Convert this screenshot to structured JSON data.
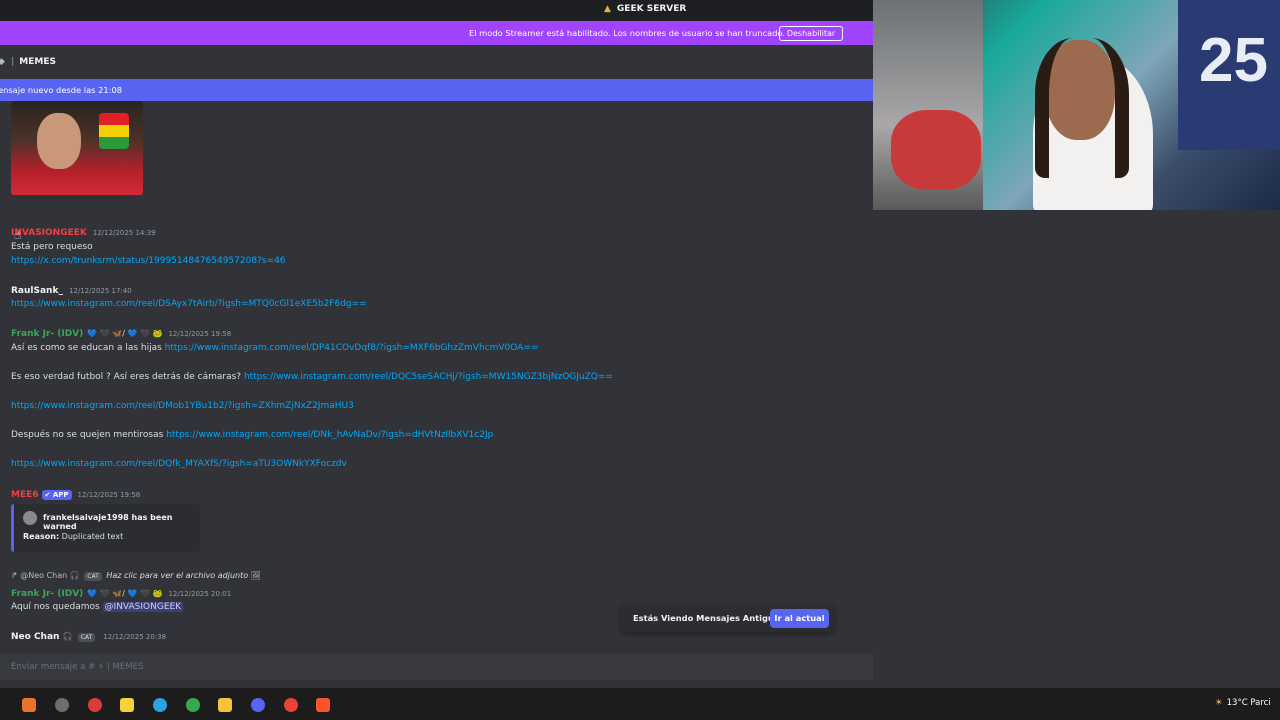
{
  "server": {
    "title": "GEEK SERVER"
  },
  "streamer": {
    "text": "El modo Streamer está habilitado. Los nombres de usuario se han truncado.",
    "button": "Deshabilitar"
  },
  "channel": {
    "name": "MEMES"
  },
  "new_messages": {
    "text": "ensaje nuevo desde las 21:08"
  },
  "messages": {
    "m1": {
      "author": "INVASIONGEEK",
      "time": "12/12/2025 14:39",
      "text": "Está pero requeso",
      "link": "https://x.com/trunksrm/status/1999514847654957208?s=46"
    },
    "m2": {
      "author": "RaulSank_",
      "time": "12/12/2025 17:40",
      "link": "https://www.instagram.com/reel/DSAyx7tAirb/?igsh=MTQ0cGl1eXE5b2F6dg=="
    },
    "m3": {
      "author": "Frank Jr- (IDV)",
      "badges": "💙 🖤 🦋/ 💙 🖤 🐸",
      "time": "12/12/2025 19:58",
      "l1_text": "Así es como se educan a las hijas ",
      "l1_link": "https://www.instagram.com/reel/DP41COvDqf8/?igsh=MXF6bGhzZmVhcmV0OA==",
      "l2_text": "Es eso verdad futbol ? Así eres detrás de cámaras? ",
      "l2_link": "https://www.instagram.com/reel/DQC5seSACHj/?igsh=MW15NGZ3bjNzOGJuZQ==",
      "l3_link": "https://www.instagram.com/reel/DMob1YBu1b2/?igsh=ZXhmZjNxZ2JmaHU3",
      "l4_text": "Después no se quejen mentirosas ",
      "l4_link": "https://www.instagram.com/reel/DNk_hAvNaDv/?igsh=dHVtNzllbXV1c2Jp",
      "l5_link": "https://www.instagram.com/reel/DQfk_MYAXfS/?igsh=aTU3OWNkYXFoczdv"
    },
    "m4": {
      "author": "MEE6",
      "app": "✔ APP",
      "time": "12/12/2025 19:58",
      "embed_title": "frankelsalvaje1998 has been warned",
      "reason_label": "Reason:",
      "reason_value": " Duplicated text"
    },
    "reply": {
      "name": "@Neo Chan",
      "tag": "CAT",
      "text": "Haz clic para ver el archivo adjunto"
    },
    "m5": {
      "author": "Frank Jr- (IDV)",
      "badges": "💙 🖤 🦋/ 💙 🖤 🐸",
      "time": "12/12/2025 20:01",
      "text": "Aquí nos quedamos ",
      "mention": "@INVASIONGEEK"
    },
    "m6": {
      "author": "Neo Chan",
      "tag": "CAT",
      "time": "12/12/2025 20:38"
    }
  },
  "toast": {
    "text": "Estás Viendo Mensajes Antiguos",
    "button": "Ir al actual"
  },
  "composer": {
    "placeholder": "Enviar mensaje a #  ⚡  |  MEMES"
  },
  "webcam": {
    "jersey_number": "25"
  },
  "taskbar": {
    "weather": "13°C  Parci"
  },
  "colors": {
    "streamer_bar": "#a044ff",
    "new_bar": "#5865f2",
    "link": "#00a8fc",
    "invasion": "#f23f43",
    "frank": "#3ba55c",
    "mee6": "#f23f43"
  }
}
